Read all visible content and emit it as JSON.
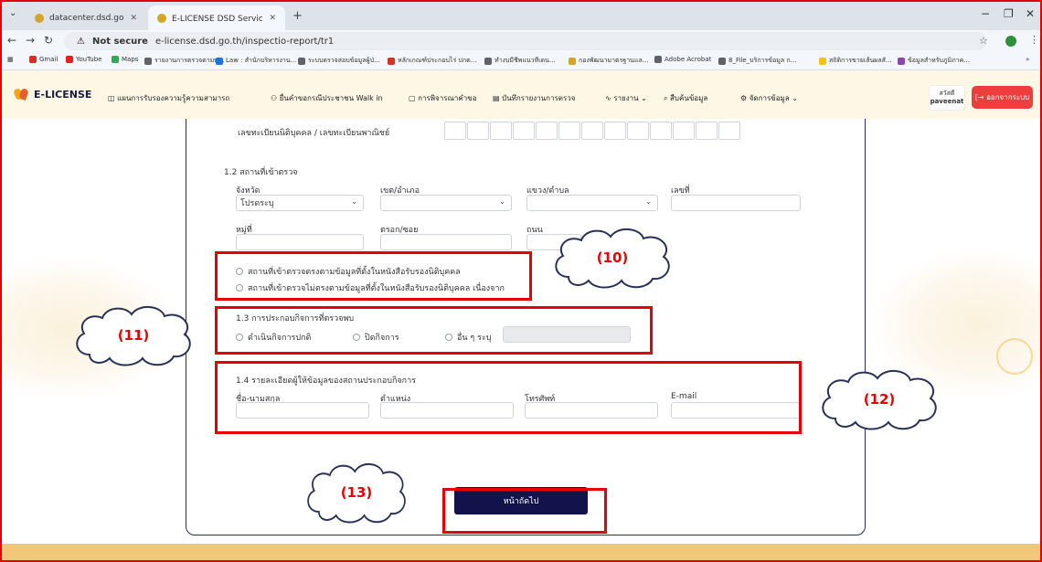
{
  "browser": {
    "tabs": [
      {
        "title": "datacenter.dsd.go.th |",
        "active": false
      },
      {
        "title": "E-LICENSE DSD Service - ระบบใ",
        "active": true
      }
    ],
    "new_tab": "+",
    "not_secure": "Not secure",
    "url": "e-license.dsd.go.th/inspectio-report/tr1",
    "bookmarks": [
      {
        "label": "Gmail",
        "color": "#d93025"
      },
      {
        "label": "YouTube",
        "color": "#e62117"
      },
      {
        "label": "Maps",
        "color": "#34a853"
      },
      {
        "label": "รายงานการตรวจตามพ...",
        "color": "#5f6368"
      },
      {
        "label": "Law : สำนักบริหารงาน...",
        "color": "#1a73e8"
      },
      {
        "label": "ระบบตรวจสอบข้อมูลผู้ป่...",
        "color": "#5f6368"
      },
      {
        "label": "หลักเกณฑ์ประกอบไร่ ปกต...",
        "color": "#d93025"
      },
      {
        "label": "ทำงบมีชีพแนวทีเดน...",
        "color": "#5f6368"
      },
      {
        "label": "กองพัฒนามาตรฐานแล...",
        "color": "#d4a627"
      },
      {
        "label": "Adobe Acrobat",
        "color": "#5f6368"
      },
      {
        "label": "8_File_บริการข้อมูล ก...",
        "color": "#5f6368"
      },
      {
        "label": "สถิติการขายเส้นผลสั...",
        "color": "#f4c20d"
      },
      {
        "label": "ข้อมูลสำหรับภูมิภาค...",
        "color": "#8e44ad"
      }
    ],
    "bookmarks_more": "»"
  },
  "app": {
    "brand": "E-LICENSE",
    "menu": [
      "แผนการรับรองความรู้ความสามารถ",
      "ยื่นคำขอกรณีประชาชน Walk in",
      "การพิจารณาคำขอ",
      "บันทึกรายงานการตรวจ",
      "รายงาน ⌄",
      "สืบค้นข้อมูล",
      "จัดการข้อมูล ⌄"
    ],
    "user_greeting": "สวัสดี",
    "user_name": "paveenat",
    "logout": "ออกจากระบบ"
  },
  "form": {
    "reg_label": "เลขทะเบียนนิติบุคคล / เลขทะเบียนพาณิชย์",
    "section_12": "1.2 สถานที่เข้าตรวจ",
    "province_label": "จังหวัด",
    "province_value": "โปรดระบุ",
    "district_label": "เขต/อำเภอ",
    "subdistrict_label": "แขวง/ตำบล",
    "number_label": "เลขที่",
    "moo_label": "หมู่ที่",
    "soi_label": "ตรอก/ซอย",
    "road_label": "ถนน",
    "location_match": "สถานที่เข้าตรวจตรงตามข้อมูลที่ตั้งในหนังสือรับรองนิติบุคคล",
    "location_mismatch": "สถานที่เข้าตรวจไม่ตรงตามข้อมูลที่ตั้งในหนังสือรับรองนิติบุคคล เนื่องจาก",
    "section_13": "1.3 การประกอบกิจการที่ตรวจพบ",
    "op_normal": "ดำเนินกิจการปกติ",
    "op_closed": "ปิดกิจการ",
    "op_other": "อื่น ๆ ระบุ",
    "section_14": "1.4 รายละเอียดผู้ให้ข้อมูลของสถานประกอบกิจการ",
    "name_label": "ชื่อ-นามสกุล",
    "position_label": "ตำแหน่ง",
    "phone_label": "โทรศัพท์",
    "email_label": "E-mail",
    "next_button": "หน้าถัดไป"
  },
  "callouts": {
    "c10": "(10)",
    "c11": "(11)",
    "c12": "(12)",
    "c13": "(13)"
  },
  "colors": {
    "accent_red": "#e60000",
    "primary_navy": "#12134a",
    "logout_red": "#ee3d3d"
  }
}
